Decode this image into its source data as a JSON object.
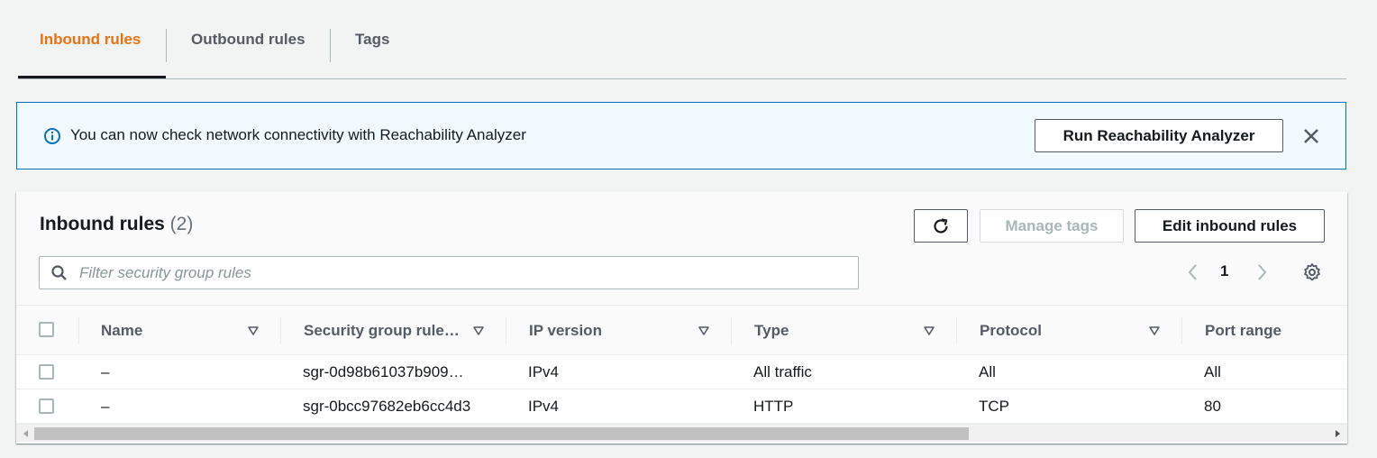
{
  "tabs": [
    {
      "label": "Inbound rules",
      "active": true
    },
    {
      "label": "Outbound rules",
      "active": false
    },
    {
      "label": "Tags",
      "active": false
    }
  ],
  "banner": {
    "icon": "info-icon",
    "message": "You can now check network connectivity with Reachability Analyzer",
    "button_label": "Run Reachability Analyzer",
    "close_icon": "close-icon"
  },
  "panel": {
    "title": "Inbound rules",
    "count": "(2)",
    "refresh_icon": "refresh-icon",
    "manage_tags_label": "Manage tags",
    "edit_label": "Edit inbound rules",
    "filter_placeholder": "Filter security group rules",
    "filter_value": "",
    "page_number": "1"
  },
  "table": {
    "columns": [
      "Name",
      "Security group rule…",
      "IP version",
      "Type",
      "Protocol",
      "Port range"
    ],
    "rows": [
      {
        "name": "–",
        "rule_id": "sgr-0d98b61037b909…",
        "ip_version": "IPv4",
        "type": "All traffic",
        "protocol": "All",
        "port_range": "All"
      },
      {
        "name": "–",
        "rule_id": "sgr-0bcc97682eb6cc4d3",
        "ip_version": "IPv4",
        "type": "HTTP",
        "protocol": "TCP",
        "port_range": "80"
      }
    ]
  },
  "colors": {
    "accent": "#ec7211",
    "info_blue": "#0073bb",
    "banner_bg": "#f1faff",
    "text": "#16191f",
    "muted": "#545b64"
  }
}
